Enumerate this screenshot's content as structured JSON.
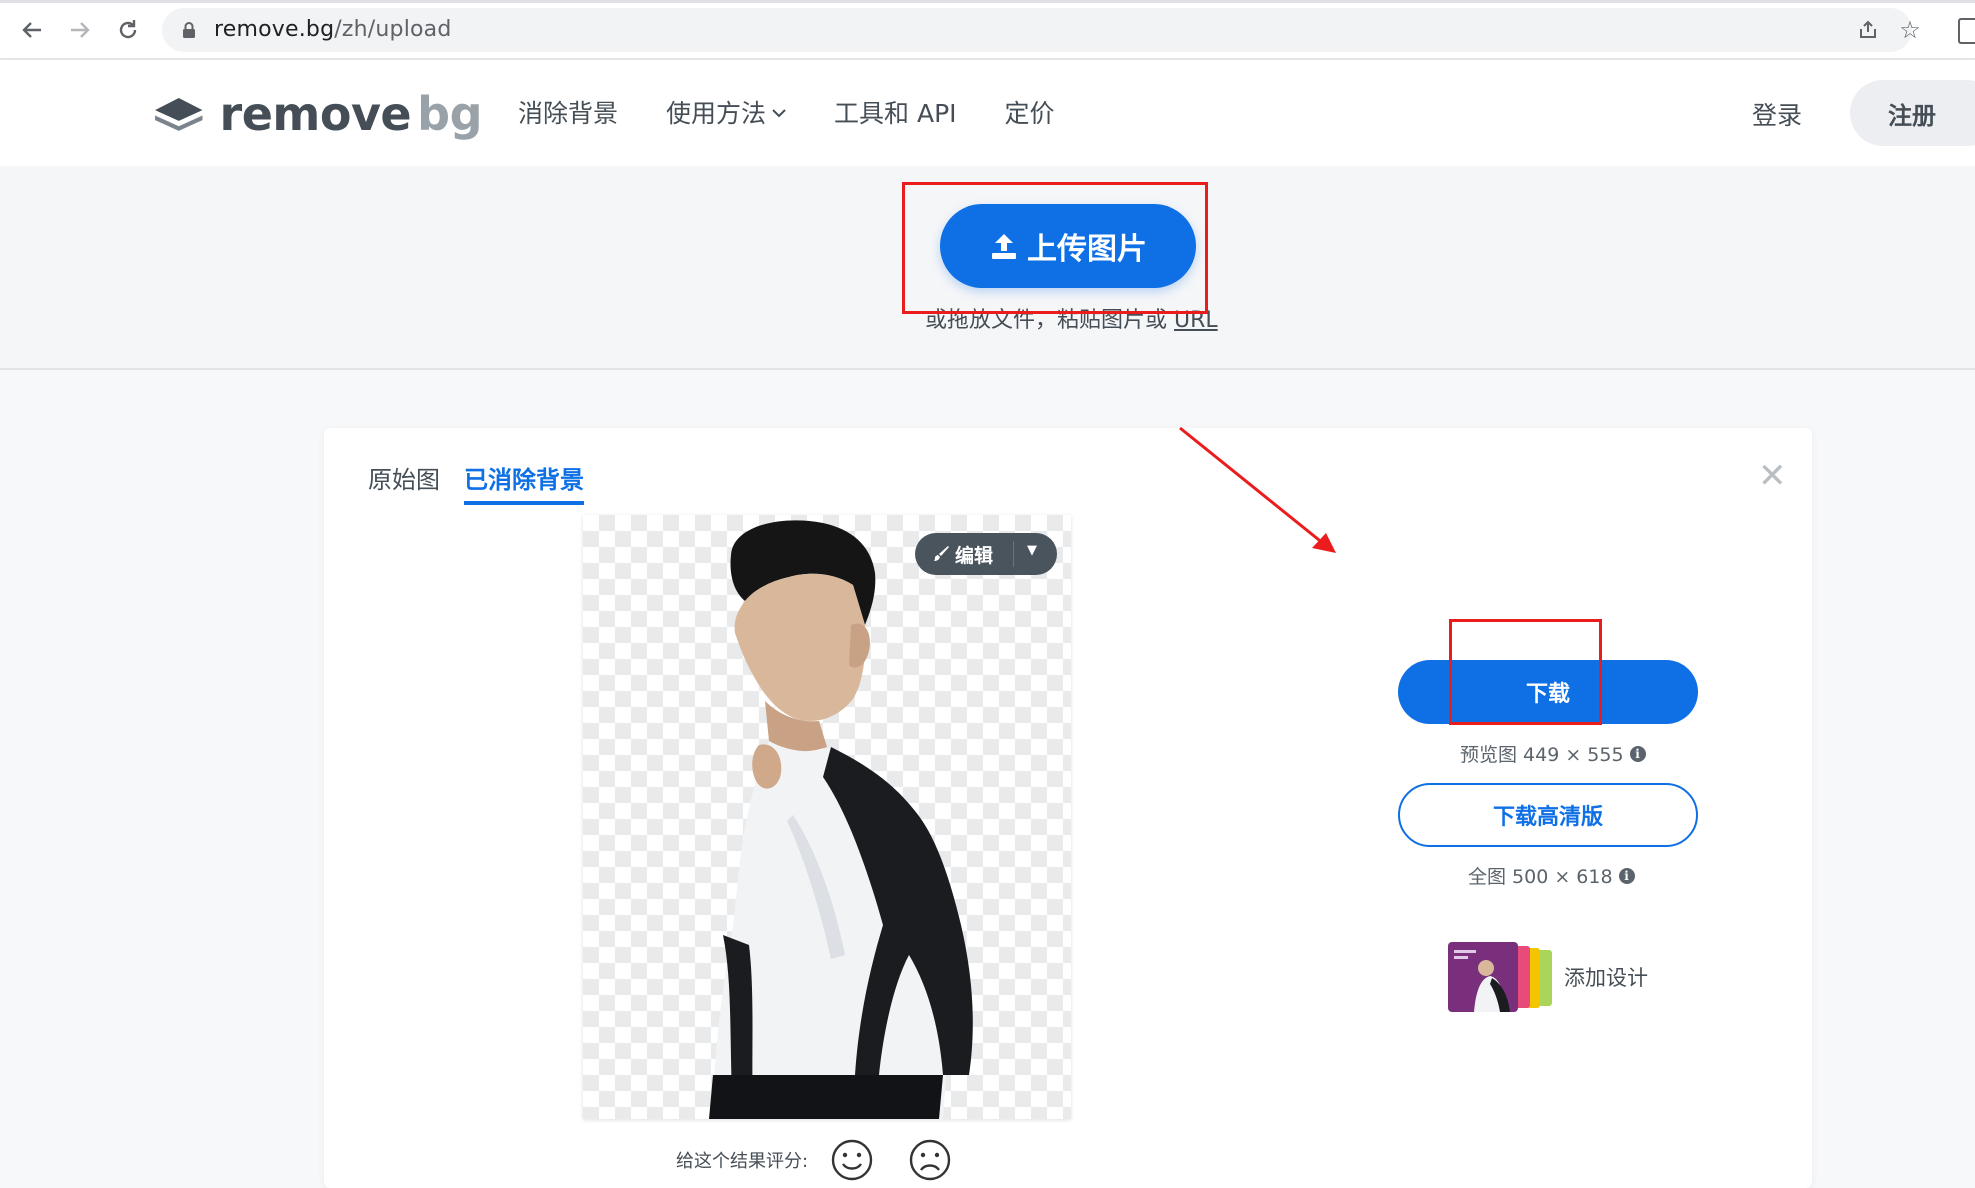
{
  "browser": {
    "url_host": "remove.bg",
    "url_path": "/zh/upload",
    "icons": [
      "back-icon",
      "forward-icon",
      "reload-icon",
      "lock-icon",
      "share-icon",
      "star-icon",
      "side-panel-icon"
    ]
  },
  "header": {
    "logo_word": "remove",
    "logo_suffix": "bg",
    "nav": [
      "消除背景",
      "使用方法",
      "工具和 API",
      "定价"
    ],
    "login_label": "登录",
    "signup_label": "注册"
  },
  "upload": {
    "button_label": "上传图片",
    "hint_text": "或拖放文件，粘贴图片或 ",
    "hint_link": "URL"
  },
  "result": {
    "tabs": [
      "原始图",
      "已消除背景"
    ],
    "active_tab": "已消除背景",
    "edit_label": "编辑",
    "download_label": "下载",
    "preview_note": "预览图 449 × 555",
    "download_hd_label": "下载高清版",
    "full_note": "全图 500 × 618",
    "add_design_label": "添加设计",
    "rating_label": "给这个结果评分:"
  },
  "colors": {
    "accent": "#0f70e6",
    "annotation_red": "#ea1c1c",
    "text_dark": "#454e56"
  }
}
